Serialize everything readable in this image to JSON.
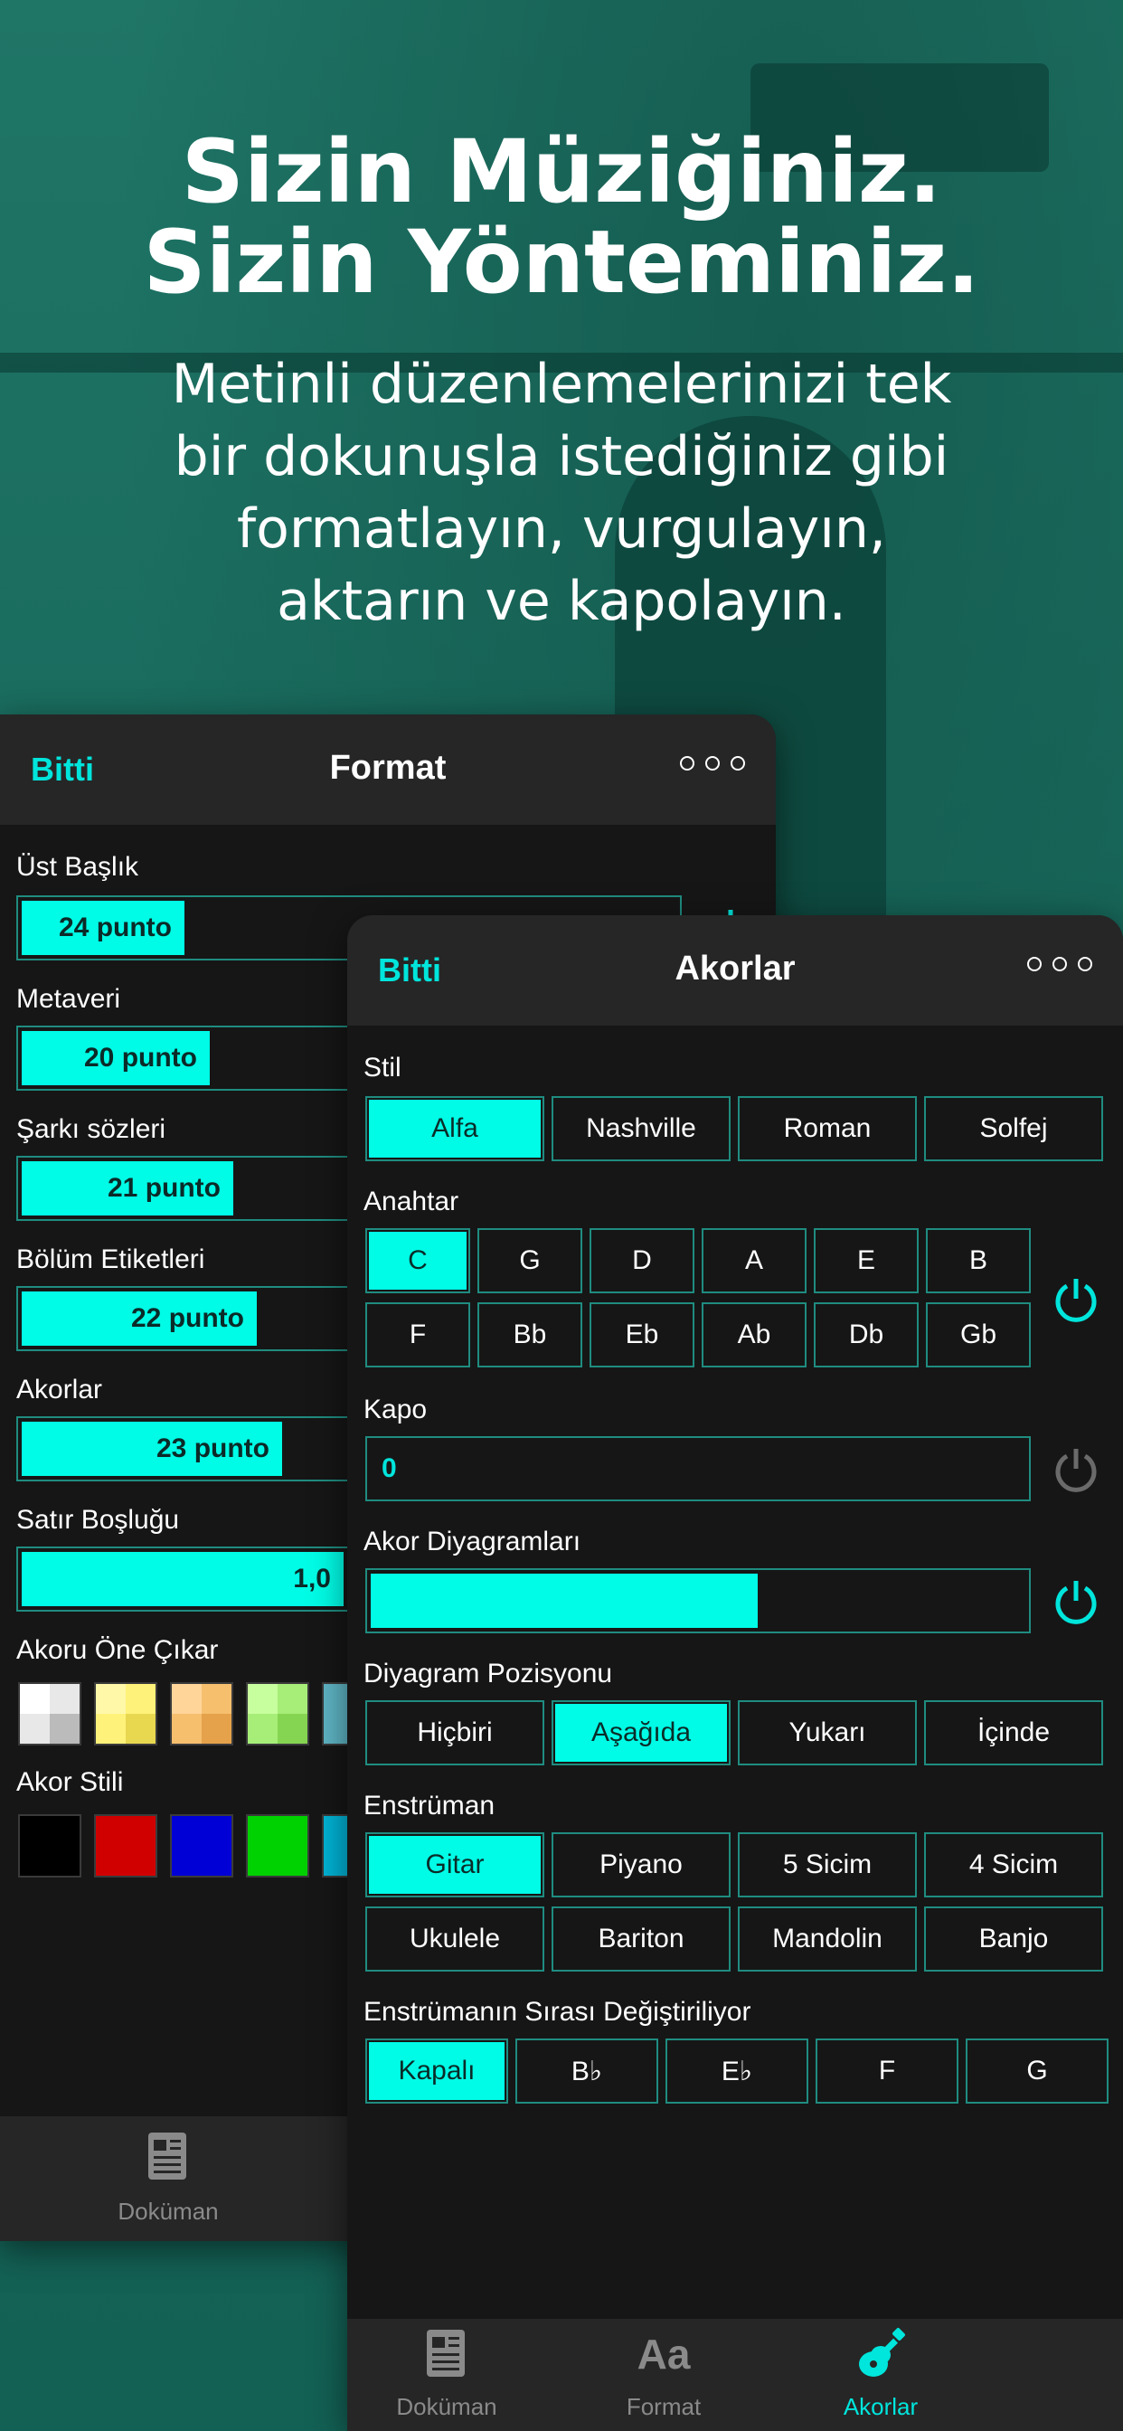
{
  "headline": {
    "line1": "Sizin Müziğiniz.",
    "line2": "Sizin Yönteminiz."
  },
  "subtitle": {
    "line1": "Metinli düzenlemelerinizi tek",
    "line2": "bir dokunuşla istediğiniz gibi",
    "line3": "formatlayın, vurgulayın,",
    "line4": "aktarın ve kapolayın."
  },
  "colors": {
    "accent": "#00fce6",
    "accent_text": "#00e5dc",
    "panel_bg": "#161616",
    "border": "#1f8c80",
    "background": "#1b6b5e"
  },
  "format_panel": {
    "done": "Bitti",
    "title": "Format",
    "rows": [
      {
        "label": "Üst Başlık",
        "value": "24 punto",
        "fill": 0.24
      },
      {
        "label": "Metaveri",
        "value": "20 punto",
        "fill": 0.29
      },
      {
        "label": "Şarkı sözleri",
        "value": "21 punto",
        "fill": 0.33
      },
      {
        "label": "Bölüm Etiketleri",
        "value": "22 punto",
        "fill": 0.37
      },
      {
        "label": "Akorlar",
        "value": "23 punto",
        "fill": 0.41
      },
      {
        "label": "Satır Boşluğu",
        "value": "1,0",
        "fill": 0.48
      }
    ],
    "highlight_label": "Akoru Öne Çıkar",
    "style_label": "Akor Stili",
    "style_colors": [
      "#000000",
      "#d10000",
      "#0000d6",
      "#00d100",
      "#00b4d6"
    ],
    "tab_document": "Doküman"
  },
  "chords_panel": {
    "done": "Bitti",
    "title": "Akorlar",
    "style": {
      "label": "Stil",
      "options": [
        "Alfa",
        "Nashville",
        "Roman",
        "Solfej"
      ],
      "selected": "Alfa"
    },
    "key": {
      "label": "Anahtar",
      "row1": [
        "C",
        "G",
        "D",
        "A",
        "E",
        "B"
      ],
      "row2": [
        "F",
        "Bb",
        "Eb",
        "Ab",
        "Db",
        "Gb"
      ],
      "selected": "C",
      "enabled": true
    },
    "capo": {
      "label": "Kapo",
      "value": "0",
      "enabled": false
    },
    "diagrams": {
      "label": "Akor Diyagramları",
      "level": 0.6,
      "enabled": true
    },
    "diagram_position": {
      "label": "Diyagram Pozisyonu",
      "options": [
        "Hiçbiri",
        "Aşağıda",
        "Yukarı",
        "İçinde"
      ],
      "selected": "Aşağıda"
    },
    "instrument": {
      "label": "Enstrüman",
      "row1": [
        "Gitar",
        "Piyano",
        "5 Sicim",
        "4 Sicim"
      ],
      "row2": [
        "Ukulele",
        "Bariton",
        "Mandolin",
        "Banjo"
      ],
      "selected": "Gitar"
    },
    "transpose": {
      "label": "Enstrümanın Sırası Değiştiriliyor",
      "options": [
        "Kapalı",
        "B♭",
        "E♭",
        "F",
        "G"
      ],
      "selected": "Kapalı"
    },
    "tabs": {
      "document": "Doküman",
      "format": "Format",
      "format_glyph": "Aa",
      "chords": "Akorlar"
    }
  }
}
